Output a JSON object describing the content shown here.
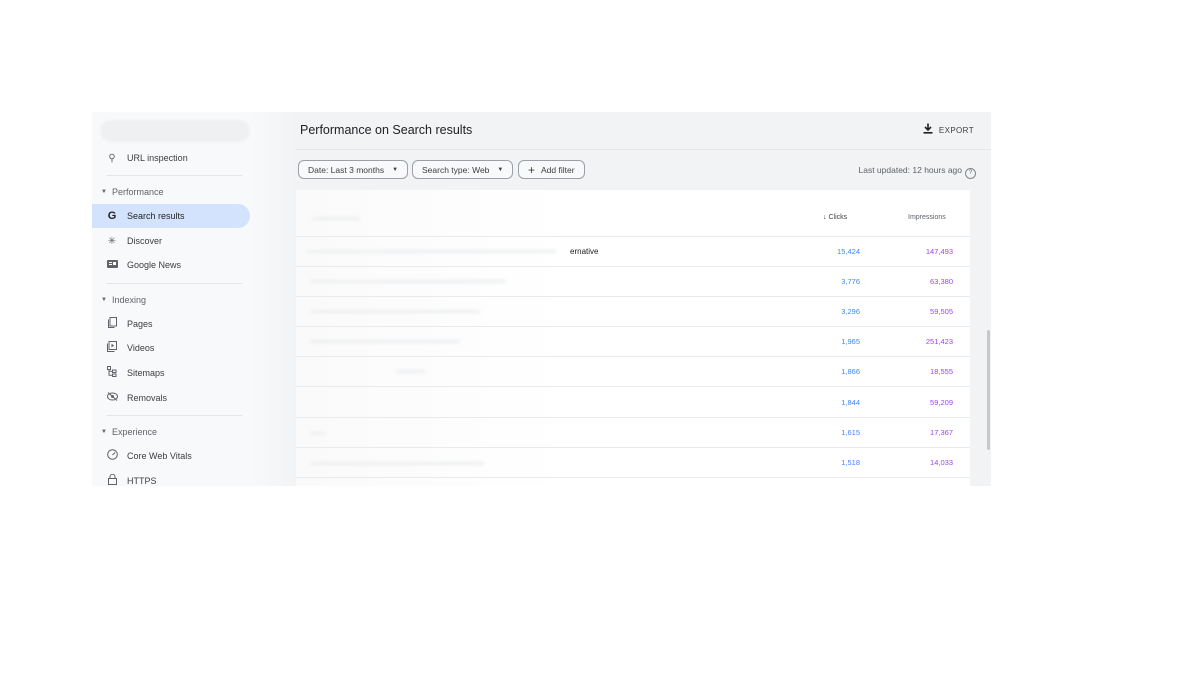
{
  "sidebar": {
    "url_inspection": "URL inspection",
    "sections": [
      {
        "label": "Performance",
        "items": [
          {
            "label": "Search results",
            "icon": "google-g-icon",
            "active": true
          },
          {
            "label": "Discover",
            "icon": "discover-asterisk-icon"
          },
          {
            "label": "Google News",
            "icon": "google-news-icon"
          }
        ]
      },
      {
        "label": "Indexing",
        "items": [
          {
            "label": "Pages",
            "icon": "pages-icon"
          },
          {
            "label": "Videos",
            "icon": "video-icon"
          },
          {
            "label": "Sitemaps",
            "icon": "sitemap-icon"
          },
          {
            "label": "Removals",
            "icon": "removals-icon"
          }
        ]
      },
      {
        "label": "Experience",
        "items": [
          {
            "label": "Core Web Vitals",
            "icon": "gauge-icon"
          },
          {
            "label": "HTTPS",
            "icon": "lock-icon"
          }
        ]
      }
    ]
  },
  "header": {
    "title": "Performance on Search results",
    "export_label": "EXPORT"
  },
  "filters": {
    "date": "Date: Last 3 months",
    "search_type": "Search type: Web",
    "add_filter": "Add filter",
    "last_updated": "Last updated: 12 hours ago"
  },
  "table": {
    "columns": {
      "clicks": "Clicks",
      "impressions": "Impressions"
    },
    "first_row_partial_text": "ernative",
    "rows": [
      {
        "clicks": "15,424",
        "impressions": "147,493"
      },
      {
        "clicks": "3,776",
        "impressions": "63,380"
      },
      {
        "clicks": "3,296",
        "impressions": "59,505"
      },
      {
        "clicks": "1,965",
        "impressions": "251,423"
      },
      {
        "clicks": "1,866",
        "impressions": "18,555"
      },
      {
        "clicks": "1,844",
        "impressions": "59,209"
      },
      {
        "clicks": "1,615",
        "impressions": "17,367"
      },
      {
        "clicks": "1,518",
        "impressions": "14,033"
      }
    ]
  },
  "colors": {
    "active_nav": "#d3e3fd",
    "clicks": "#4285f4",
    "impressions": "#a142f4"
  }
}
